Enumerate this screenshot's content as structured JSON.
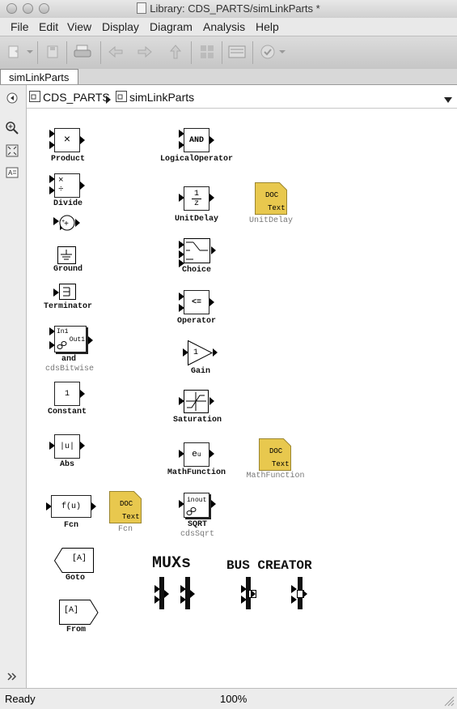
{
  "window": {
    "title": "Library: CDS_PARTS/simLinkParts *"
  },
  "menu": [
    "File",
    "Edit",
    "View",
    "Display",
    "Diagram",
    "Analysis",
    "Help"
  ],
  "tab": {
    "label": "simLinkParts"
  },
  "breadcrumb": {
    "root": "CDS_PARTS",
    "child": "simLinkParts"
  },
  "blocks": {
    "product": {
      "symbol": "×",
      "label": "Product"
    },
    "divide": {
      "symbol_top": "×",
      "symbol_bottom": "÷",
      "label": "Divide"
    },
    "ground": {
      "label": "Ground"
    },
    "terminator": {
      "label": "Terminator"
    },
    "and": {
      "in": "In1",
      "out": "Out1",
      "label": "and",
      "sublabel": "cdsBitwise"
    },
    "constant": {
      "value": "1",
      "label": "Constant"
    },
    "abs": {
      "symbol": "|u|",
      "label": "Abs"
    },
    "fcn": {
      "expr": "f(u)",
      "label": "Fcn"
    },
    "fcn_doc": {
      "doc": "DOC",
      "text": "Text",
      "label": "Fcn"
    },
    "goto": {
      "tag": "[A]",
      "label": "Goto"
    },
    "from": {
      "tag": "[A]",
      "label": "From"
    },
    "logical": {
      "op": "AND",
      "label": "LogicalOperator"
    },
    "unitdelay": {
      "num": "1",
      "den": "z",
      "label": "UnitDelay"
    },
    "unitdelay_doc": {
      "doc": "DOC",
      "text": "Text",
      "label": "UnitDelay"
    },
    "choice": {
      "label": "Choice"
    },
    "operator": {
      "op": "<=",
      "label": "Operator"
    },
    "gain": {
      "value": "1",
      "label": "Gain"
    },
    "saturation": {
      "label": "Saturation"
    },
    "mathfunction": {
      "base": "e",
      "exp": "u",
      "label": "MathFunction"
    },
    "mathfunction_doc": {
      "doc": "DOC",
      "text": "Text",
      "label": "MathFunction"
    },
    "sqrt": {
      "in": "in",
      "out": "out",
      "label": "SQRT",
      "sublabel": "cdsSqrt"
    }
  },
  "annotations": {
    "muxs": "MUXs",
    "bus_creator": "BUS CREATOR"
  },
  "status": {
    "left": "Ready",
    "zoom": "100%"
  },
  "toolbar_icons": [
    "new-model-icon",
    "save-icon",
    "print-icon",
    "back-icon",
    "forward-icon",
    "up-icon",
    "model-browser-icon",
    "library-icon",
    "check-icon"
  ]
}
